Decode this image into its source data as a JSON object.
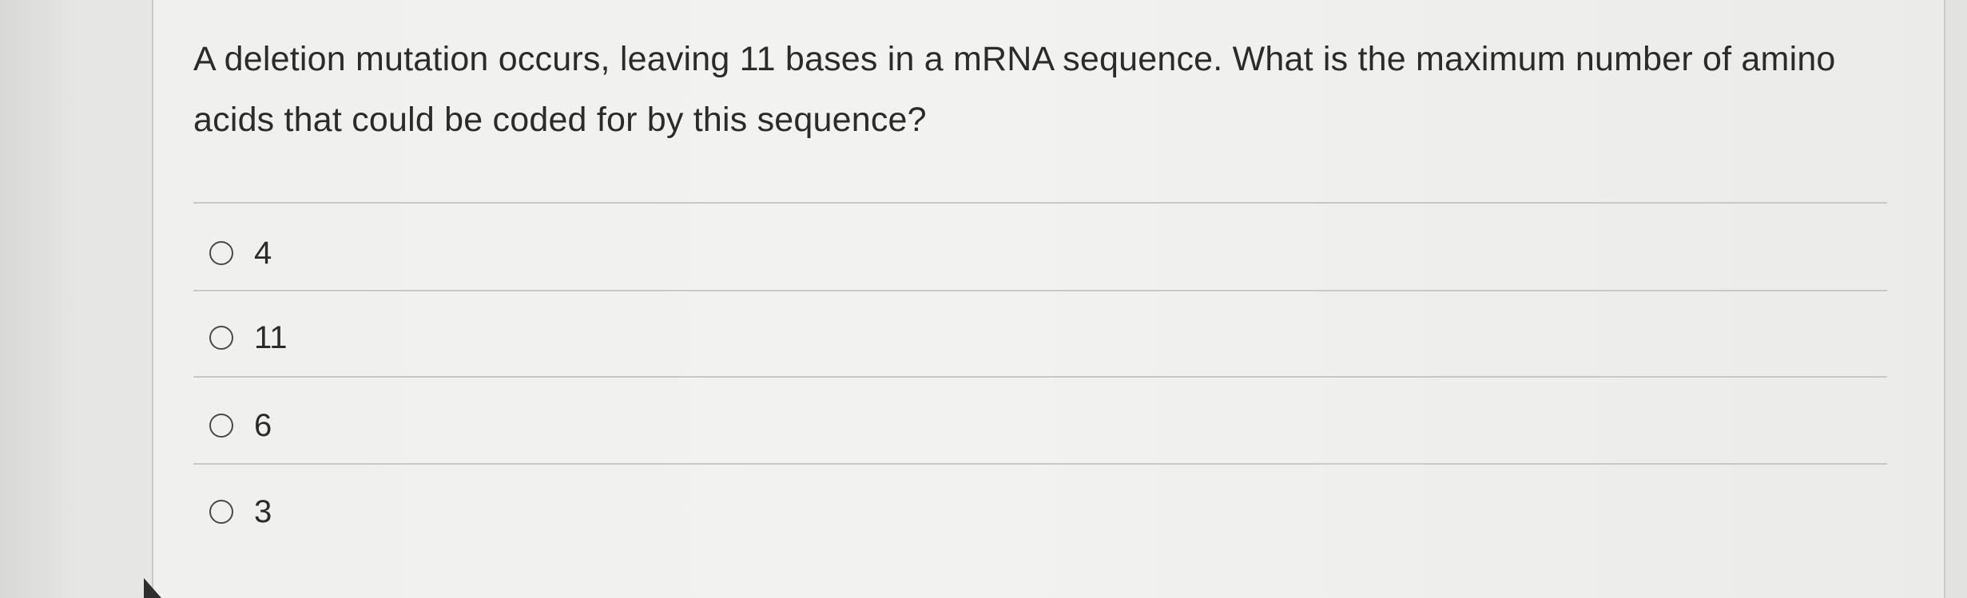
{
  "question": {
    "text": "A deletion mutation occurs, leaving 11 bases in a mRNA sequence. What is the maximum number of amino acids that could be coded for by this sequence?"
  },
  "options": [
    {
      "label": "4",
      "selected": false
    },
    {
      "label": "11",
      "selected": false
    },
    {
      "label": "6",
      "selected": false
    },
    {
      "label": "3",
      "selected": false
    }
  ],
  "icons": {
    "radio": "radio-unchecked-icon",
    "cursor": "cursor-icon"
  }
}
